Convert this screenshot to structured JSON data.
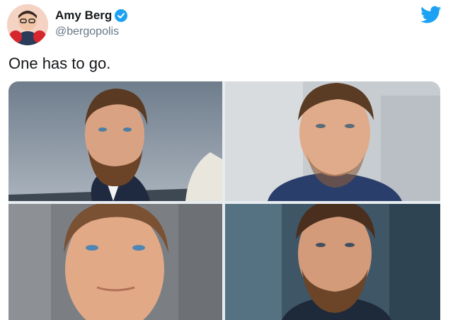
{
  "author": {
    "display_name": "Amy Berg",
    "handle": "@bergopolis",
    "verified": true
  },
  "tweet": {
    "text": "One has to go."
  },
  "icons": {
    "verified": "verified-badge-icon",
    "platform": "twitter-bird-icon"
  },
  "colors": {
    "accent": "#1da1f2",
    "name": "#14171a",
    "handle": "#657786"
  },
  "media": [
    {
      "name": "photo-top-left"
    },
    {
      "name": "photo-top-right"
    },
    {
      "name": "photo-bottom-left"
    },
    {
      "name": "photo-bottom-right"
    }
  ]
}
